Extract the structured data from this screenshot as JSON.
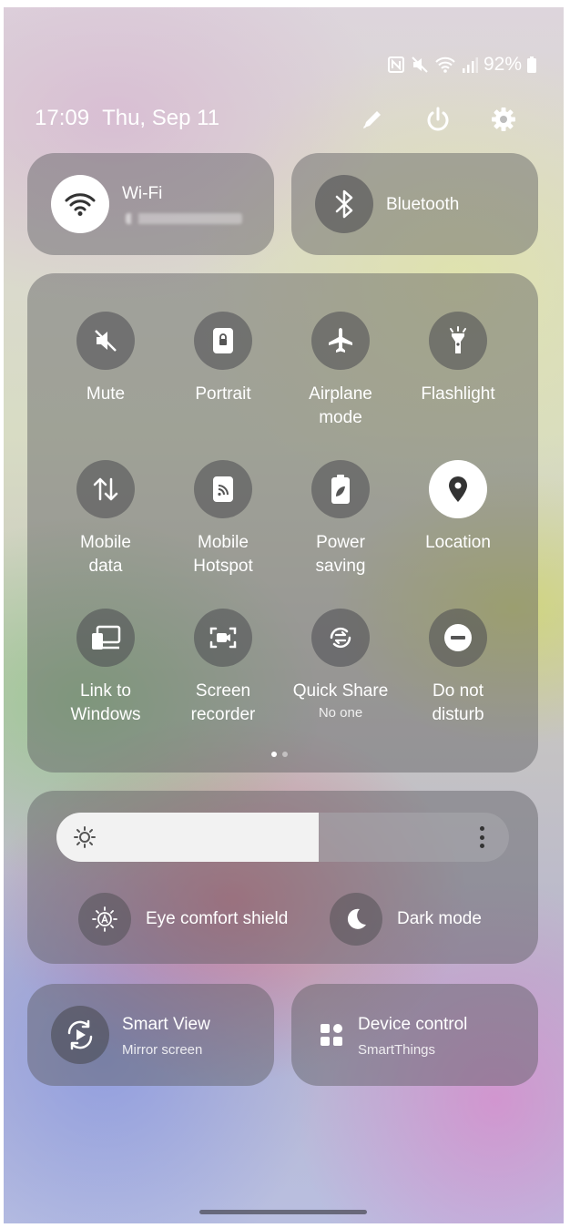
{
  "status_bar": {
    "battery": "92%",
    "icons": [
      "nfc-icon",
      "mute-icon",
      "wifi-icon",
      "signal-icon",
      "battery-icon"
    ]
  },
  "header": {
    "time": "17:09",
    "date": "Thu, Sep 11",
    "actions": [
      "edit-icon",
      "power-icon",
      "settings-icon"
    ]
  },
  "wifi": {
    "label": "Wi-Fi",
    "state": "on"
  },
  "bluetooth": {
    "label": "Bluetooth",
    "state": "off"
  },
  "quick_settings": [
    {
      "label": "Mute",
      "icon": "mute-icon",
      "state": "off"
    },
    {
      "label": "Portrait",
      "icon": "portrait-lock-icon",
      "state": "off"
    },
    {
      "label": "Airplane\nmode",
      "icon": "airplane-icon",
      "state": "off"
    },
    {
      "label": "Flashlight",
      "icon": "flashlight-icon",
      "state": "off"
    },
    {
      "label": "Mobile\ndata",
      "icon": "mobile-data-icon",
      "state": "off"
    },
    {
      "label": "Mobile\nHotspot",
      "icon": "hotspot-icon",
      "state": "off"
    },
    {
      "label": "Power\nsaving",
      "icon": "power-saving-icon",
      "state": "off"
    },
    {
      "label": "Location",
      "icon": "location-icon",
      "state": "on"
    },
    {
      "label": "Link to\nWindows",
      "icon": "link-windows-icon",
      "state": "off"
    },
    {
      "label": "Screen\nrecorder",
      "icon": "screen-recorder-icon",
      "state": "off"
    },
    {
      "label": "Quick Share",
      "sub": "No one",
      "icon": "quick-share-icon",
      "state": "off"
    },
    {
      "label": "Do not\ndisturb",
      "icon": "do-not-disturb-icon",
      "state": "off"
    }
  ],
  "pager": {
    "pages": 2,
    "current": 1
  },
  "brightness": {
    "level_percent": 58
  },
  "eye_comfort": {
    "label": "Eye comfort shield"
  },
  "dark_mode": {
    "label": "Dark mode"
  },
  "smart_view": {
    "title": "Smart View",
    "subtitle": "Mirror screen"
  },
  "device_control": {
    "title": "Device control",
    "subtitle": "SmartThings"
  },
  "colors": {
    "active_tile": "#ffffff",
    "tile_bg": "rgba(90,90,95,0.45)",
    "text": "#ffffff"
  }
}
